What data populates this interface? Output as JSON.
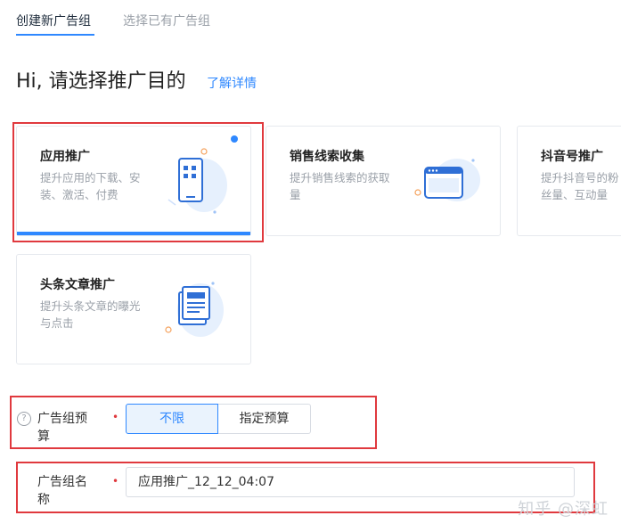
{
  "tabs": {
    "create_new": "创建新广告组",
    "select_existing": "选择已有广告组"
  },
  "heading": "Hi, 请选择推广目的",
  "learn_more": "了解详情",
  "cards": [
    {
      "title": "应用推广",
      "desc": "提升应用的下载、安装、激活、付费",
      "selected": true
    },
    {
      "title": "销售线索收集",
      "desc": "提升销售线索的获取量",
      "selected": false
    },
    {
      "title": "抖音号推广",
      "desc": "提升抖音号的粉丝量、互动量",
      "selected": false
    },
    {
      "title": "头条文章推广",
      "desc": "提升头条文章的曝光与点击",
      "selected": false
    }
  ],
  "budget": {
    "label": "广告组预算",
    "required_mark": "•",
    "options": [
      "不限",
      "指定预算"
    ],
    "selected": "不限"
  },
  "name": {
    "label": "广告组名称",
    "required_mark": "•",
    "value": "应用推广_12_12_04:07"
  },
  "watermark": "知乎 @深虹",
  "colors": {
    "accent": "#2f88ff",
    "highlight_box": "#e0393e"
  }
}
